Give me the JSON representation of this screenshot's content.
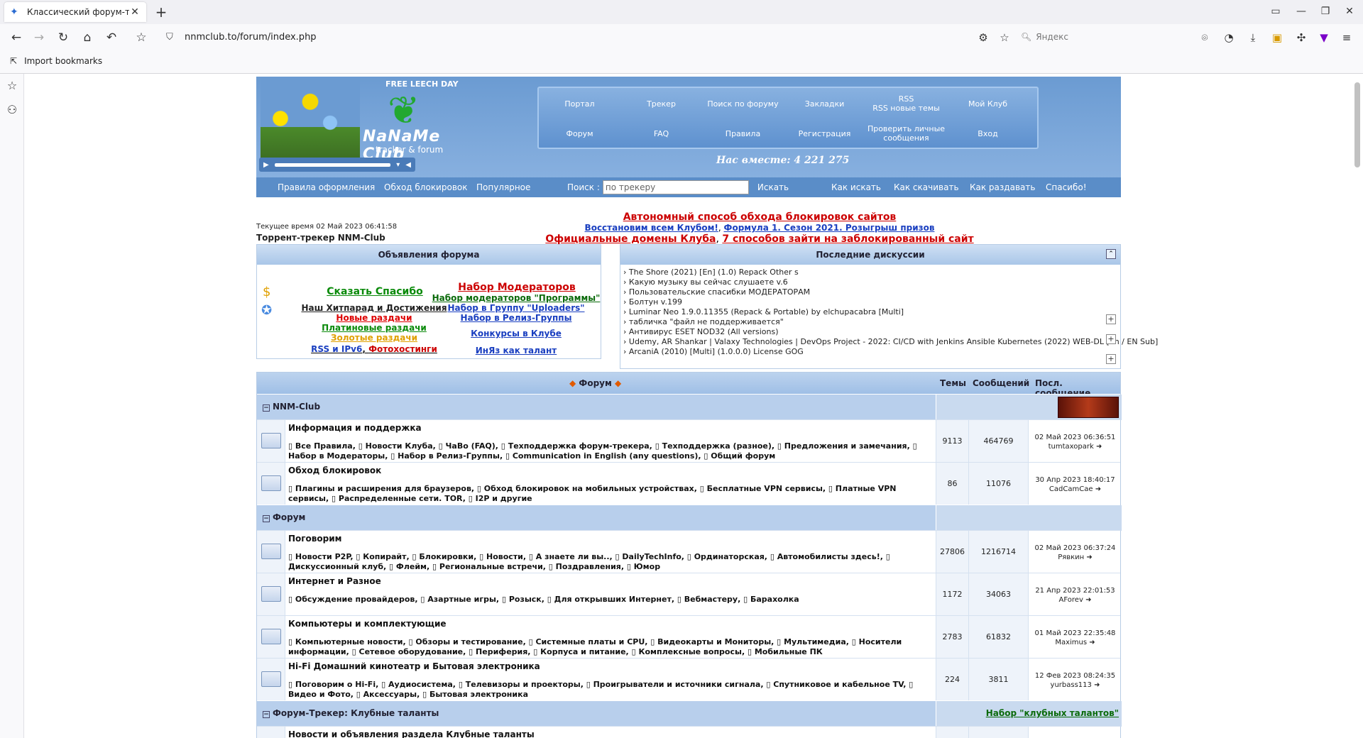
{
  "browser": {
    "tab_title": "Классический форум-т",
    "url": "nnmclub.to/forum/index.php",
    "search_placeholder": "Яндекс",
    "bookmarks_import": "Import bookmarks"
  },
  "header": {
    "free_leech": "FREE LEECH DAY",
    "logo_name": "NaNaMe Club",
    "logo_sub": "tracker & forum",
    "together": "Нас вместе: 4 221 275",
    "menu": [
      "Портал",
      "Трекер",
      "Поиск по форуму",
      "Закладки",
      "RSS\nRSS новые темы",
      "Мой Клуб",
      "Форум",
      "FAQ",
      "Правила",
      "Регистрация",
      "Проверить личные сообщения",
      "Вход"
    ],
    "nav": {
      "rules": "Правила оформления",
      "bypass": "Обход блокировок",
      "popular": "Популярное",
      "search_label": "Поиск :",
      "search_placeholder": "по трекеру",
      "search_btn": "Искать",
      "howsearch": "Как искать",
      "howdl": "Как скачивать",
      "howseed": "Как раздавать",
      "thanks": "Спасибо!"
    }
  },
  "info": {
    "time": "Текущее время 02 Май 2023 06:41:58",
    "tracker": "Торрент-трекер NNM-Club",
    "link1": "Автономный способ обхода блокировок сайтов",
    "link2a": "Восстановим всем Клубом!",
    "link2sep": ", ",
    "link2b": "Формула 1. Сезон 2021. Розыгрыш призов",
    "link3a": "Официальные домены Клуба",
    "link3sep": ", ",
    "link3b": "7 способов зайти на заблокированный сайт"
  },
  "announce": {
    "title": "Объявления форума",
    "say_thanks": "Сказать Спасибо",
    "hitparad": "Наш Хитпарад и Достижения",
    "new": "Новые раздачи",
    "platinum": "Платиновые раздачи",
    "gold": "Золотые раздачи",
    "rss": "RSS и IPv6",
    "rss_sep": ", ",
    "photohost": "Фотохостинги",
    "mods": "Набор Модераторов",
    "mods_prog": "Набор модераторов \"Программы\"",
    "uploaders": "Набор в Группу \"Uploaders\"",
    "release": "Набор в Релиз-Группы",
    "contests": "Конкурсы в Клубе",
    "english": "ИнЯз как талант"
  },
  "discussions": {
    "title": "Последние дискуссии",
    "items": [
      "The Shore (2021) [En] (1.0) Repack Other s",
      "Какую музыку вы сейчас слушаете v.6",
      "Пользовательские спасибки МОДЕРАТОРАМ",
      "Болтун v.199",
      "Luminar Neo 1.9.0.11355 (Repack & Portable) by elchupacabra [Multi]",
      "табличка \"файл не поддерживается\"",
      "Антивирус ESET NOD32 (All versions)",
      "Udemy, AR Shankar | Valaxy Technologies | DevOps Project - 2022: CI/CD with Jenkins Ansible Kubernetes (2022) WEB-DL [En / EN Sub]",
      "ArcaniA (2010) [Multi] (1.0.0.0) License GOG"
    ]
  },
  "forum_table": {
    "h_forum": "Форум",
    "h_topics": "Темы",
    "h_posts": "Сообщений",
    "h_last": "Посл. сообщение",
    "cat1": "NNM-Club",
    "cat2": "Форум",
    "cat3": "Форум-Трекер: Клубные таланты",
    "cat3_link": "Набор \"клубных талантов\"",
    "rows": [
      {
        "name": "Информация и поддержка",
        "subs": "Все Правила, Новости Клуба, ЧаВо (FAQ), Техподдержка форум-трекера, Техподдержка (разное), Предложения и замечания, Набор в Модераторы, Набор в Релиз-Группы, Communication in English (any questions), Общий форум",
        "topics": "9113",
        "posts": "464769",
        "last_date": "02 Май 2023 06:36:51",
        "last_user": "tumtaxopark"
      },
      {
        "name": "Обход блокировок",
        "subs": "Плагины и расширения для браузеров, Обход блокировок на мобильных устройствах, Бесплатные VPN сервисы, Платные VPN сервисы, Распределенные сети. TOR, I2P и другие",
        "topics": "86",
        "posts": "11076",
        "last_date": "30 Апр 2023 18:40:17",
        "last_user": "CadCamCae"
      },
      {
        "name": "Поговорим",
        "subs": "Новости P2P, Копирайт, Блокировки, Новости, А знаете ли вы.., DailyTechInfo, Ординаторская, Автомобилисты здесь!, Дискуссионный клуб, Флейм, Региональные встречи, Поздравления, Юмор",
        "topics": "27806",
        "posts": "1216714",
        "last_date": "02 Май 2023 06:37:24",
        "last_user": "Рявкин"
      },
      {
        "name": "Интернет и Разное",
        "subs": "Обсуждение провайдеров, Азартные игры, Розыск, Для открывших Интернет, Вебмастеру, Барахолка",
        "topics": "1172",
        "posts": "34063",
        "last_date": "21 Апр 2023 22:01:53",
        "last_user": "AForev"
      },
      {
        "name": "Компьютеры и комплектующие",
        "subs": "Компьютерные новости, Обзоры и тестирование, Системные платы и CPU, Видеокарты и Мониторы, Мультимедиа, Носители информации, Сетевое оборудование, Периферия, Корпуса и питание, Комплексные вопросы, Мобильные ПК",
        "topics": "2783",
        "posts": "61832",
        "last_date": "01 Май 2023 22:35:48",
        "last_user": "Maximus"
      },
      {
        "name": "Hi-Fi Домашний кинотеатр и Бытовая электроника",
        "subs": "Поговорим о Hi-Fi, Аудиосистема, Телевизоры и проекторы, Проигрыватели и источники сигнала, Спутниковое и кабельное TV, Видео и Фото, Аксессуары, Бытовая электроника",
        "topics": "224",
        "posts": "3811",
        "last_date": "12 Фев 2023 08:24:35",
        "last_user": "yurbass113"
      },
      {
        "name": "Новости и объявления раздела Клубные таланты",
        "subs": "",
        "topics": "",
        "posts": "",
        "last_date": "",
        "last_user": ""
      }
    ]
  }
}
